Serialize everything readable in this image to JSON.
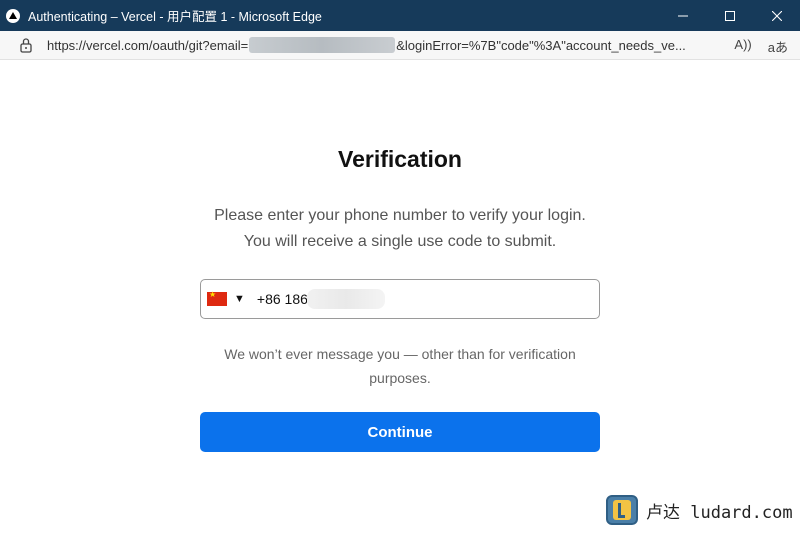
{
  "window": {
    "title": "Authenticating – Vercel - 用户配置 1 - Microsoft Edge",
    "controls": [
      "minimize",
      "maximize",
      "close"
    ]
  },
  "addressbar": {
    "url_prefix": "https://vercel.com/oauth/git?email=",
    "url_suffix": "&loginError=%7B\"code\"%3A\"account_needs_ve...",
    "read_aloud_label": "Aͅ",
    "translate_label": "aあ"
  },
  "page": {
    "heading": "Verification",
    "instruction_line1": "Please enter your phone number to verify your login.",
    "instruction_line2": "You will receive a single use code to submit.",
    "phone": {
      "country_code": "+86 186",
      "country": "CN",
      "caret": "▼"
    },
    "note_line1": "We won’t ever message you — other than for verification",
    "note_line2": "purposes.",
    "continue_label": "Continue"
  },
  "watermark": {
    "text": "卢达 ludard.com"
  },
  "colors": {
    "titlebar": "#163a5a",
    "button": "#0b72ec"
  }
}
